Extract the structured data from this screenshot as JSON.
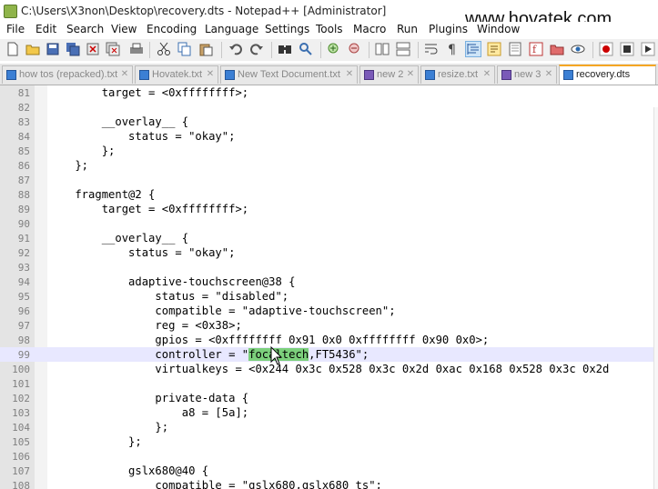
{
  "window": {
    "title": "C:\\Users\\X3non\\Desktop\\recovery.dts - Notepad++ [Administrator]",
    "watermark": "www.hovatek.com"
  },
  "menu": [
    "File",
    "Edit",
    "Search",
    "View",
    "Encoding",
    "Language",
    "Settings",
    "Tools",
    "Macro",
    "Run",
    "Plugins",
    "Window"
  ],
  "tabs": [
    {
      "label": "how tos (repacked).txt",
      "active": false
    },
    {
      "label": "Hovatek.txt",
      "active": false
    },
    {
      "label": "New Text Document.txt",
      "active": false
    },
    {
      "label": "new 2",
      "active": false
    },
    {
      "label": "resize.txt",
      "active": false
    },
    {
      "label": "new 3",
      "active": false
    },
    {
      "label": "recovery.dts",
      "active": true
    }
  ],
  "editor": {
    "current_line": "99",
    "highlighted_word": "focaltech",
    "lines": [
      {
        "n": "81",
        "text": "        target = <0xffffffff>;"
      },
      {
        "n": "82",
        "text": ""
      },
      {
        "n": "83",
        "text": "        __overlay__ {"
      },
      {
        "n": "84",
        "text": "            status = \"okay\";"
      },
      {
        "n": "85",
        "text": "        };"
      },
      {
        "n": "86",
        "text": "    };"
      },
      {
        "n": "87",
        "text": ""
      },
      {
        "n": "88",
        "text": "    fragment@2 {"
      },
      {
        "n": "89",
        "text": "        target = <0xffffffff>;"
      },
      {
        "n": "90",
        "text": ""
      },
      {
        "n": "91",
        "text": "        __overlay__ {"
      },
      {
        "n": "92",
        "text": "            status = \"okay\";"
      },
      {
        "n": "93",
        "text": ""
      },
      {
        "n": "94",
        "text": "            adaptive-touchscreen@38 {"
      },
      {
        "n": "95",
        "text": "                status = \"disabled\";"
      },
      {
        "n": "96",
        "text": "                compatible = \"adaptive-touchscreen\";"
      },
      {
        "n": "97",
        "text": "                reg = <0x38>;"
      },
      {
        "n": "98",
        "text": "                gpios = <0xffffffff 0x91 0x0 0xffffffff 0x90 0x0>;"
      },
      {
        "n": "99",
        "pre": "                controller = \"",
        "hl": "focaltech",
        "post": ",FT5436\";"
      },
      {
        "n": "100",
        "text": "                virtualkeys = <0x244 0x3c 0x528 0x3c 0x2d 0xac 0x168 0x528 0x3c 0x2d"
      },
      {
        "n": "101",
        "text": ""
      },
      {
        "n": "102",
        "text": "                private-data {"
      },
      {
        "n": "103",
        "text": "                    a8 = [5a];"
      },
      {
        "n": "104",
        "text": "                };"
      },
      {
        "n": "105",
        "text": "            };"
      },
      {
        "n": "106",
        "text": ""
      },
      {
        "n": "107",
        "text": "            gslx680@40 {"
      },
      {
        "n": "108",
        "text": "                compatible = \"gslx680,gslx680_ts\";"
      }
    ]
  }
}
